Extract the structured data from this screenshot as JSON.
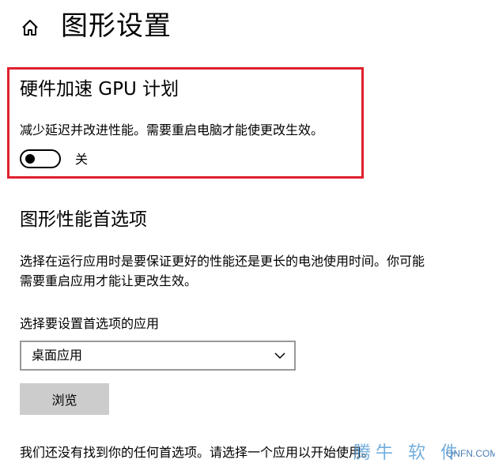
{
  "header": {
    "home_icon": "home-icon",
    "title": "图形设置"
  },
  "gpu_scheduling": {
    "title": "硬件加速 GPU 计划",
    "description": "减少延迟并改进性能。需要重启电脑才能使更改生效。",
    "toggle_on": false,
    "toggle_state_label": "关",
    "highlight_color": "#e0202d"
  },
  "graphics_performance": {
    "title": "图形性能首选项",
    "description_line1": "选择在运行应用时是要保证更好的性能还是更长的电池使用时间。你可能",
    "description_line2": "需要重启应用才能让更改生效。",
    "select_label": "选择要设置首选项的应用",
    "select_value": "桌面应用",
    "browse_label": "浏览",
    "empty_message": "我们还没有找到你的任何首选项。请选择一个应用以开始使用。"
  },
  "watermark": {
    "glyphs": "腾牛 软 件",
    "domain": "QNFN.COM"
  }
}
